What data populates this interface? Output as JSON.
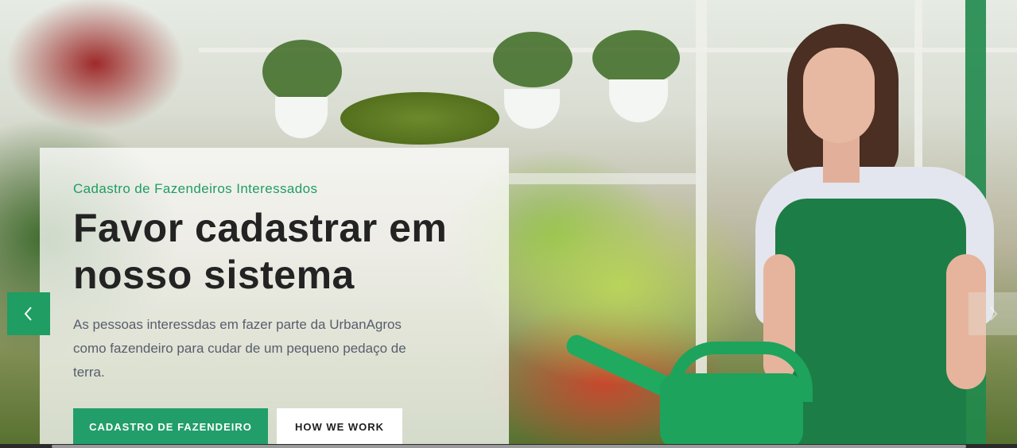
{
  "hero": {
    "eyebrow": "Cadastro de Fazendeiros Interessados",
    "headline": "Favor cadastrar em nosso sistema",
    "description": "As pessoas interessdas em fazer parte da UrbanAgros como fazendeiro para cudar de um pequeno pedaço de terra.",
    "primary_button": "CADASTRO DE FAZENDEIRO",
    "secondary_button": "HOW WE WORK",
    "background_image": "woman-watering-plants-greenhouse-photo"
  },
  "carousel": {
    "prev_icon": "chevron-left-icon",
    "next_icon": "chevron-right-icon"
  },
  "colors": {
    "accent": "#229e6a",
    "eyebrow": "#1f9d62",
    "headline": "#232323",
    "body_text": "#575e6b"
  }
}
